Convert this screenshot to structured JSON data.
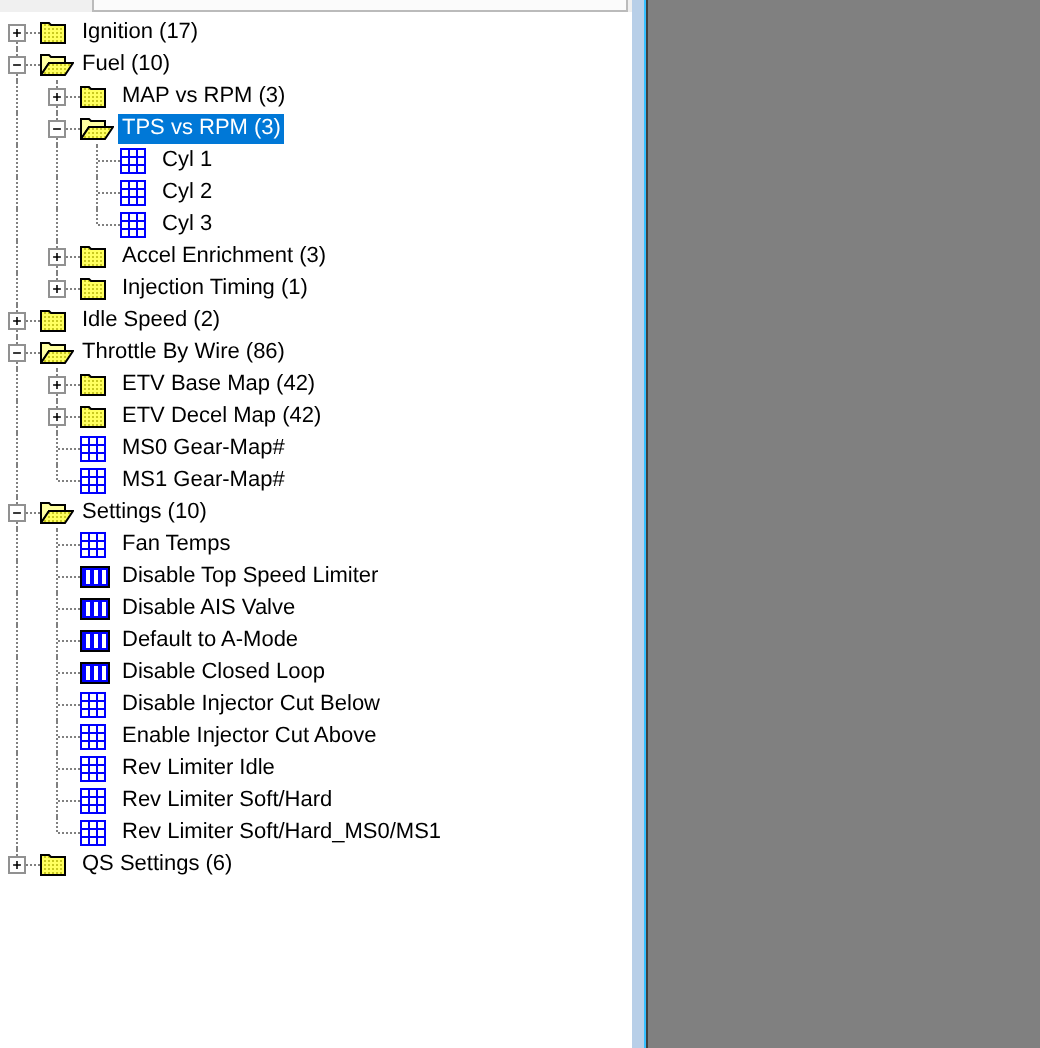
{
  "tree": [
    {
      "label": "Ignition (17)",
      "kind": "folder",
      "expanded": false,
      "selected": false
    },
    {
      "label": "Fuel (10)",
      "kind": "folder",
      "expanded": true,
      "selected": false,
      "children": [
        {
          "label": "MAP vs RPM (3)",
          "kind": "folder",
          "expanded": false,
          "selected": false
        },
        {
          "label": "TPS vs RPM (3)",
          "kind": "folder",
          "expanded": true,
          "selected": true,
          "children": [
            {
              "label": "Cyl 1",
              "kind": "table",
              "selected": false
            },
            {
              "label": "Cyl 2",
              "kind": "table",
              "selected": false
            },
            {
              "label": "Cyl 3",
              "kind": "table",
              "selected": false
            }
          ]
        },
        {
          "label": "Accel Enrichment (3)",
          "kind": "folder",
          "expanded": false,
          "selected": false
        },
        {
          "label": "Injection Timing (1)",
          "kind": "folder",
          "expanded": false,
          "selected": false
        }
      ]
    },
    {
      "label": "Idle Speed (2)",
      "kind": "folder",
      "expanded": false,
      "selected": false
    },
    {
      "label": "Throttle By Wire (86)",
      "kind": "folder",
      "expanded": true,
      "selected": false,
      "children": [
        {
          "label": "ETV Base Map (42)",
          "kind": "folder",
          "expanded": false,
          "selected": false
        },
        {
          "label": "ETV Decel Map (42)",
          "kind": "folder",
          "expanded": false,
          "selected": false
        },
        {
          "label": "MS0 Gear-Map#",
          "kind": "table",
          "selected": false
        },
        {
          "label": "MS1 Gear-Map#",
          "kind": "table",
          "selected": false
        }
      ]
    },
    {
      "label": "Settings (10)",
      "kind": "folder",
      "expanded": true,
      "selected": false,
      "children": [
        {
          "label": "Fan Temps",
          "kind": "table",
          "selected": false
        },
        {
          "label": "Disable Top Speed Limiter",
          "kind": "toggle",
          "selected": false
        },
        {
          "label": "Disable AIS Valve",
          "kind": "toggle",
          "selected": false
        },
        {
          "label": "Default to A-Mode",
          "kind": "toggle",
          "selected": false
        },
        {
          "label": "Disable Closed Loop",
          "kind": "toggle",
          "selected": false
        },
        {
          "label": "Disable Injector Cut Below",
          "kind": "table",
          "selected": false
        },
        {
          "label": "Enable Injector Cut Above",
          "kind": "table",
          "selected": false
        },
        {
          "label": "Rev Limiter Idle",
          "kind": "table",
          "selected": false
        },
        {
          "label": "Rev Limiter Soft/Hard",
          "kind": "table",
          "selected": false
        },
        {
          "label": "Rev Limiter Soft/Hard_MS0/MS1",
          "kind": "table",
          "selected": false
        }
      ]
    },
    {
      "label": "QS Settings (6)",
      "kind": "folder",
      "expanded": false,
      "selected": false
    }
  ]
}
